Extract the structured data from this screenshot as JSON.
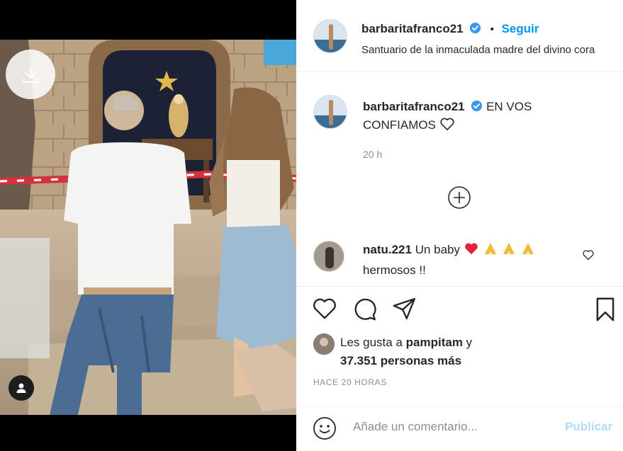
{
  "post": {
    "username": "barbaritafranco21",
    "follow_label": "Seguir",
    "dot": "•",
    "location": "Santuario de la inmaculada madre del divino cora",
    "caption_text": "EN VOS CONFIAMOS",
    "caption_icon": "heart-outline-icon",
    "caption_time": "20 h"
  },
  "comment": {
    "username": "natu.221",
    "text_start": "Un baby",
    "emoji_heart": "heart-red-icon",
    "emoji_hands": "praying-hands-icon",
    "text_end": "hermosos !!"
  },
  "likes": {
    "prefix": "Les gusta a",
    "user": "pampitam",
    "conjunction": "y",
    "count_text": "37.351 personas más"
  },
  "timestamp": "HACE 20 HORAS",
  "composer": {
    "placeholder": "Añade un comentario...",
    "publish_label": "Publicar"
  },
  "colors": {
    "accent": "#0095f6",
    "publish_disabled": "#b3dbff",
    "muted": "#8e8e8e",
    "heart": "#ed4956"
  }
}
